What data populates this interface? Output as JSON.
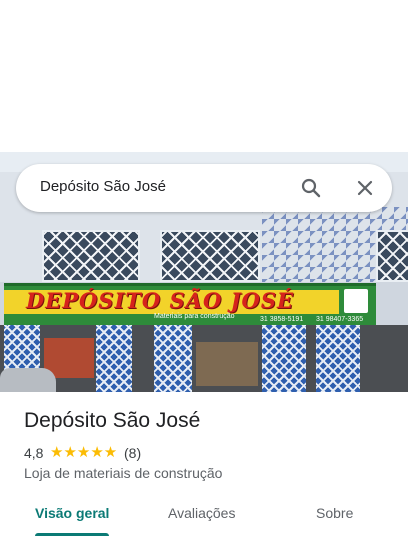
{
  "search": {
    "query": "Depósito São José",
    "search_icon": "search-icon",
    "close_icon": "close-icon"
  },
  "photo": {
    "sign_title": "DEPÓSITO SÃO JOSÉ",
    "sign_subtitle": "Materiais para construção",
    "sign_phone_1": "31 3858-5191",
    "sign_phone_2": "31 98407-3365"
  },
  "place": {
    "name": "Depósito São José",
    "rating": "4,8",
    "stars": "★★★★★",
    "review_count": "(8)",
    "category": "Loja de materiais de construção"
  },
  "tabs": [
    {
      "label": "Visão geral",
      "active": true
    },
    {
      "label": "Avaliações",
      "active": false
    },
    {
      "label": "Sobre",
      "active": false
    }
  ],
  "colors": {
    "accent": "#0b7a75",
    "star": "#fbbc04"
  }
}
